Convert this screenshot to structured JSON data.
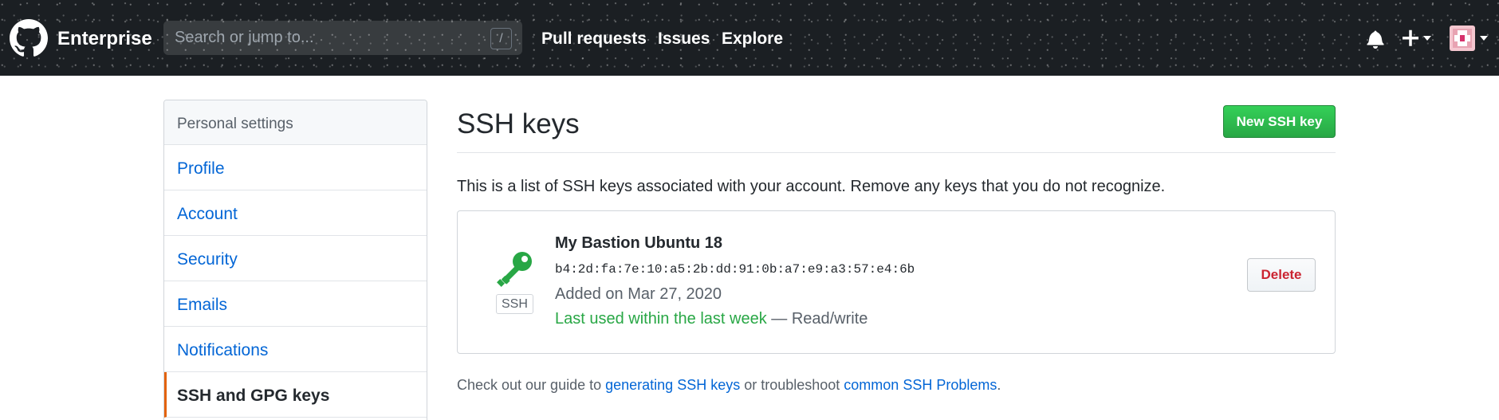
{
  "header": {
    "brand": "Enterprise",
    "search_placeholder": "Search or jump to...",
    "search_shortcut": "/",
    "nav": [
      "Pull requests",
      "Issues",
      "Explore"
    ],
    "icons": [
      "github-logo-icon",
      "bell-icon",
      "plus-icon",
      "caret-down-icon",
      "avatar"
    ]
  },
  "sidebar": {
    "heading": "Personal settings",
    "items": [
      {
        "label": "Profile"
      },
      {
        "label": "Account"
      },
      {
        "label": "Security"
      },
      {
        "label": "Emails"
      },
      {
        "label": "Notifications"
      },
      {
        "label": "SSH and GPG keys",
        "selected": true
      }
    ]
  },
  "main": {
    "title": "SSH keys",
    "new_button": "New SSH key",
    "intro": "This is a list of SSH keys associated with your account. Remove any keys that you do not recognize.",
    "keys": [
      {
        "title": "My Bastion Ubuntu 18",
        "fingerprint": "b4:2d:fa:7e:10:a5:2b:dd:91:0b:a7:e9:a3:57:e4:6b",
        "added": "Added on Mar 27, 2020",
        "last_used": "Last used within the last week",
        "access": " — Read/write",
        "badge": "SSH",
        "delete_label": "Delete"
      }
    ],
    "guide": {
      "prefix": "Check out our guide to ",
      "link1": "generating SSH keys",
      "middle": " or troubleshoot ",
      "link2": "common SSH Problems",
      "suffix": "."
    }
  },
  "colors": {
    "header_bg": "#1b1f23",
    "link": "#0366d6",
    "primary_button": "#28a745",
    "danger": "#cb2431",
    "selected_accent": "#e36209",
    "key_icon": "#28a745"
  }
}
